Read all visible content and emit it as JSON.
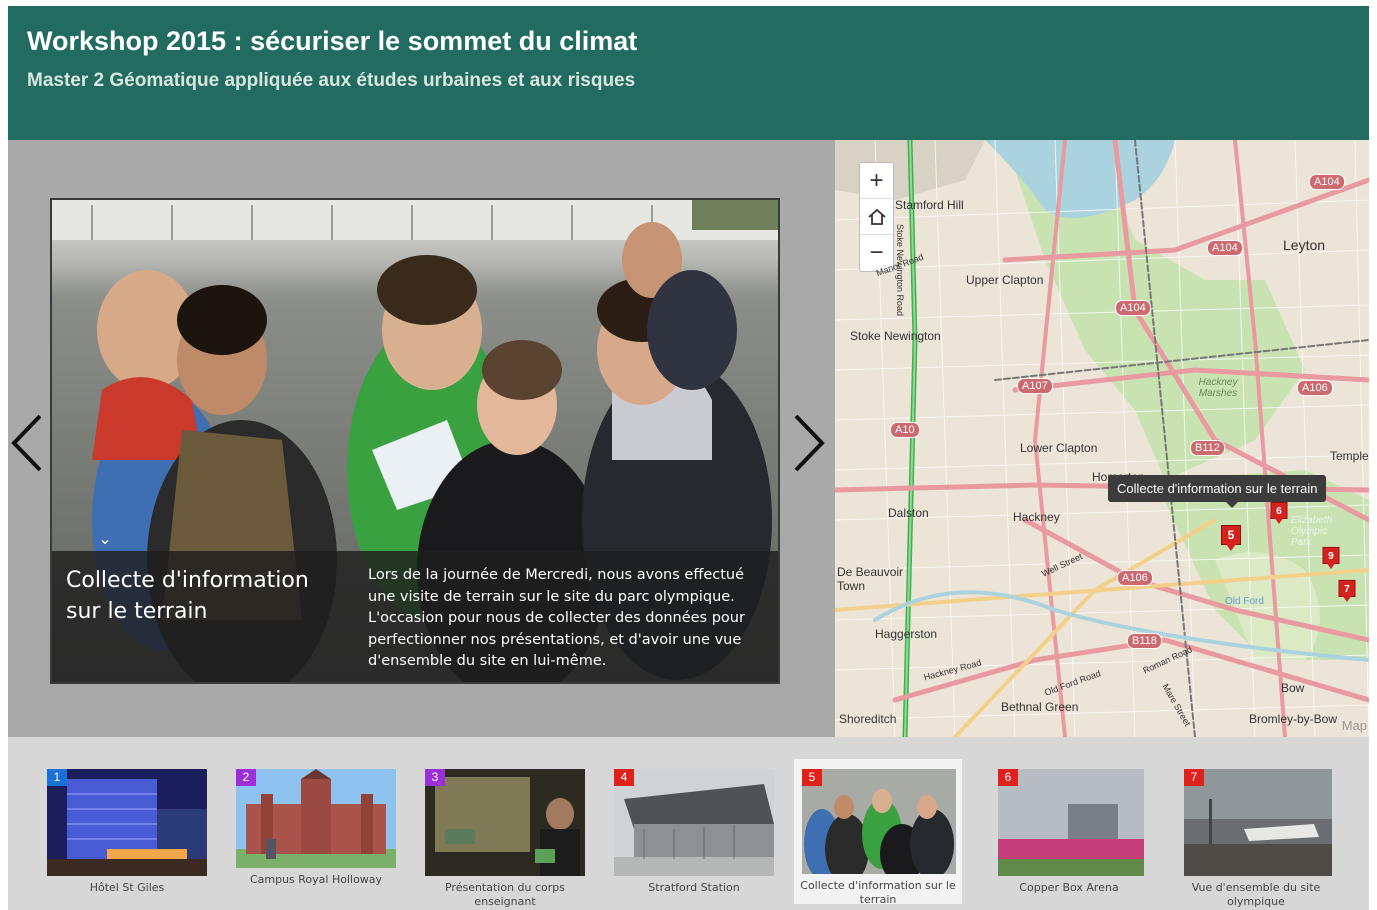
{
  "header": {
    "title": "Workshop 2015 : sécuriser le sommet du climat",
    "subtitle": "Master 2 Géomatique appliquée aux études urbaines et aux risques"
  },
  "slide": {
    "title": "Collecte d'information sur le terrain",
    "text": "Lors de la journée de Mercredi, nous avons effectué une visite de terrain sur le site du parc olympique. L'occasion pour nous de collecter des données pour perfectionner nos présentations, et d'avoir une vue d'ensemble du site en lui-même."
  },
  "nav": {
    "prev_icon": "chevron-left-icon",
    "next_icon": "chevron-right-icon",
    "collapse_icon": "chevron-down-icon"
  },
  "map": {
    "zoom_in": "+",
    "zoom_out": "−",
    "home_icon": "home-icon",
    "tooltip": "Collecte d'information sur le terrain",
    "attribution": "Map",
    "places": [
      {
        "name": "Stamford Hill"
      },
      {
        "name": "Leyton"
      },
      {
        "name": "Upper Clapton"
      },
      {
        "name": "Stoke Newington"
      },
      {
        "name": "Hackney Marshes"
      },
      {
        "name": "Lower Clapton"
      },
      {
        "name": "Temple"
      },
      {
        "name": "Dalston"
      },
      {
        "name": "Hackney"
      },
      {
        "name": "De Beauvoir Town"
      },
      {
        "name": "Haggerston"
      },
      {
        "name": "Bow"
      },
      {
        "name": "Bethnal Green"
      },
      {
        "name": "Shoreditch"
      },
      {
        "name": "Bromley-by-Bow"
      },
      {
        "name": "Elizabeth Olympic Park"
      },
      {
        "name": "Old Ford"
      },
      {
        "name": "Homerton"
      },
      {
        "name": "Stoke Newington Road"
      },
      {
        "name": "Manor Road"
      },
      {
        "name": "Hackney Road"
      },
      {
        "name": "Well Street"
      },
      {
        "name": "Old Ford Road"
      },
      {
        "name": "Roman Road"
      },
      {
        "name": "Mare Street"
      }
    ],
    "roads": [
      "A104",
      "A104",
      "A104",
      "A107",
      "A106",
      "A10",
      "B112",
      "A106",
      "B118"
    ],
    "markers": [
      "5",
      "6",
      "9",
      "7"
    ]
  },
  "thumbnails": [
    {
      "num": "1",
      "label": "Hôtel St Giles",
      "color": "#1a72d9"
    },
    {
      "num": "2",
      "label": "Campus Royal Holloway",
      "color": "#9b30d9"
    },
    {
      "num": "3",
      "label": "Présentation du corps enseignant",
      "color": "#9b30d9"
    },
    {
      "num": "4",
      "label": "Stratford Station",
      "color": "#e0201a"
    },
    {
      "num": "5",
      "label": "Collecte d'information sur le terrain",
      "color": "#e0201a"
    },
    {
      "num": "6",
      "label": "Copper Box Arena",
      "color": "#e0201a"
    },
    {
      "num": "7",
      "label": "Vue d'ensemble du site olympique",
      "color": "#e0201a"
    }
  ],
  "colors": {
    "header_bg": "#226b60",
    "stage_bg": "#a9a9a9",
    "strip_bg": "#d7d7d7",
    "marker_red": "#d6221f"
  }
}
